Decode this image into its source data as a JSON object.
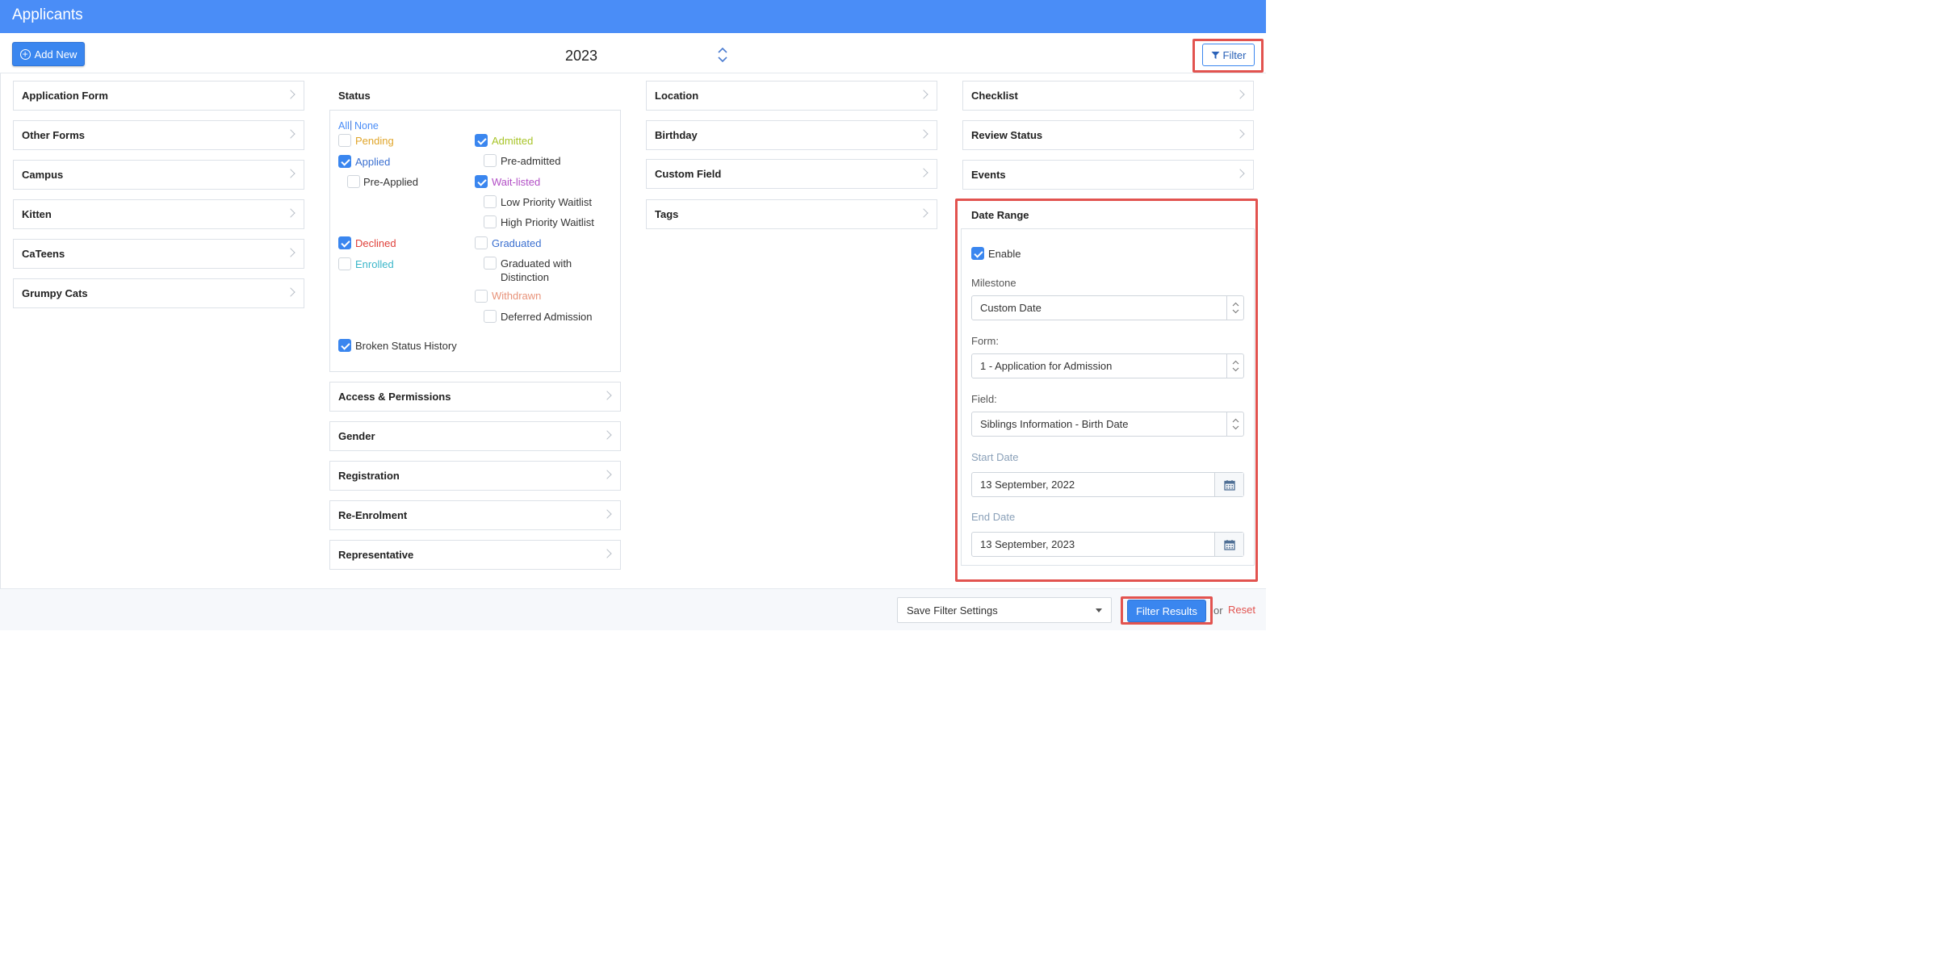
{
  "header": {
    "title": "Applicants"
  },
  "toolbar": {
    "add_new_label": "Add New",
    "year": "2023",
    "filter_label": "Filter"
  },
  "columns": {
    "col1": [
      "Application Form",
      "Other Forms",
      "Campus",
      "Kitten",
      "CaTeens",
      "Grumpy Cats"
    ],
    "col2_below_status": [
      "Access & Permissions",
      "Gender",
      "Registration",
      "Re-Enrolment",
      "Representative"
    ],
    "col3": [
      "Location",
      "Birthday",
      "Custom Field",
      "Tags"
    ],
    "col4": [
      "Checklist",
      "Review Status",
      "Events"
    ]
  },
  "status": {
    "title": "Status",
    "all_label": "All",
    "separator": "|",
    "none_label": "None",
    "items": [
      {
        "label": "Pending",
        "checked": false,
        "color": "#e0a52a"
      },
      {
        "label": "Applied",
        "checked": true,
        "color": "#3a6fd0"
      },
      {
        "label": "Pre-Applied",
        "checked": false,
        "color": "#333333"
      },
      {
        "label": "Declined",
        "checked": true,
        "color": "#e0413b"
      },
      {
        "label": "Enrolled",
        "checked": false,
        "color": "#3ab6c9"
      },
      {
        "label": "Admitted",
        "checked": true,
        "color": "#a8c427"
      },
      {
        "label": "Pre-admitted",
        "checked": false,
        "color": "#333333"
      },
      {
        "label": "Wait-listed",
        "checked": true,
        "color": "#b24fc6"
      },
      {
        "label": "Low Priority Waitlist",
        "checked": false,
        "color": "#333333"
      },
      {
        "label": "High Priority Waitlist",
        "checked": false,
        "color": "#333333"
      },
      {
        "label": "Graduated",
        "checked": false,
        "color": "#3a6fd0"
      },
      {
        "label": "Graduated with",
        "checked": false,
        "color": "#333333"
      },
      {
        "label": "Distinction",
        "checked": false,
        "color": "#333333"
      },
      {
        "label": "Withdrawn",
        "checked": false,
        "color": "#e8937a"
      },
      {
        "label": "Deferred Admission",
        "checked": false,
        "color": "#333333"
      }
    ],
    "broken_history_label": "Broken Status History",
    "broken_history_checked": true
  },
  "date_range": {
    "title": "Date Range",
    "enable_label": "Enable",
    "enable_checked": true,
    "milestone_label": "Milestone",
    "milestone_value": "Custom Date",
    "form_label": "Form:",
    "form_value": "1 - Application for Admission",
    "field_label": "Field:",
    "field_value": "Siblings Information - Birth Date",
    "start_label": "Start Date",
    "start_value": "13 September, 2022",
    "end_label": "End Date",
    "end_value": "13 September, 2023"
  },
  "footer": {
    "save_filter_label": "Save Filter Settings",
    "filter_results_label": "Filter Results",
    "or_text": "or",
    "reset_label": "Reset"
  },
  "colors": {
    "brand": "#4a8df7",
    "highlight": "#e2534f",
    "reset": "#e2534f"
  }
}
